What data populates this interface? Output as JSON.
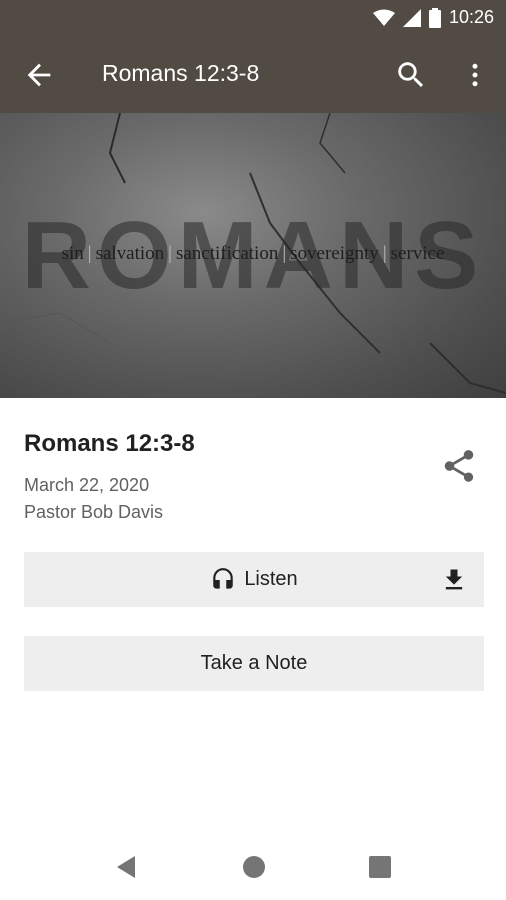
{
  "status_bar": {
    "time": "10:26",
    "icons": [
      "wifi-icon",
      "cell-signal-icon",
      "battery-icon"
    ]
  },
  "app_bar": {
    "title": "Romans 12:3-8",
    "icons": [
      "back-arrow-icon",
      "search-icon",
      "more-vert-icon"
    ],
    "background": "#514b43"
  },
  "hero": {
    "big_title": "ROMANS",
    "tags": [
      "sin",
      "salvation",
      "sanctification",
      "sovereignty",
      "service"
    ],
    "separator": "|"
  },
  "sermon": {
    "title": "Romans 12:3-8",
    "date": "March 22, 2020",
    "speaker": "Pastor Bob Davis",
    "share_icon": "share-icon"
  },
  "actions": {
    "listen_label": "Listen",
    "listen_icon": "headphones-icon",
    "download_icon": "download-icon",
    "note_label": "Take a Note",
    "button_background": "#eeeeee"
  },
  "nav_bar": {
    "icons": [
      "nav-back-icon",
      "nav-home-icon",
      "nav-recents-icon"
    ]
  }
}
